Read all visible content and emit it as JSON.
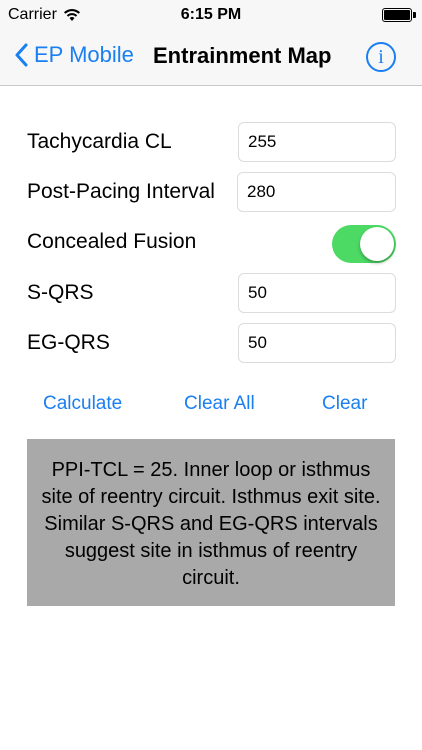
{
  "status_bar": {
    "carrier": "Carrier",
    "time": "6:15 PM",
    "battery_level": 1.0
  },
  "nav": {
    "back_label": "EP Mobile",
    "title": "Entrainment Map",
    "info_icon": "info-icon"
  },
  "form": {
    "tachycardia_cl": {
      "label": "Tachycardia CL",
      "value": "255"
    },
    "ppi": {
      "label": "Post-Pacing Interval",
      "value": "280"
    },
    "concealed_fusion": {
      "label": "Concealed Fusion",
      "on": true
    },
    "s_qrs": {
      "label": "S-QRS",
      "value": "50"
    },
    "eg_qrs": {
      "label": "EG-QRS",
      "value": "50"
    }
  },
  "actions": {
    "calculate": "Calculate",
    "clear_all": "Clear All",
    "clear": "Clear"
  },
  "result": {
    "text": "PPI-TCL = 25. Inner loop or isthmus site of reentry circuit. Isthmus exit site. Similar S-QRS and EG-QRS intervals suggest site in isthmus of reentry circuit."
  },
  "colors": {
    "accent": "#1a7ff0",
    "toggle_on": "#4cd964",
    "result_bg": "#a9a9a9"
  }
}
